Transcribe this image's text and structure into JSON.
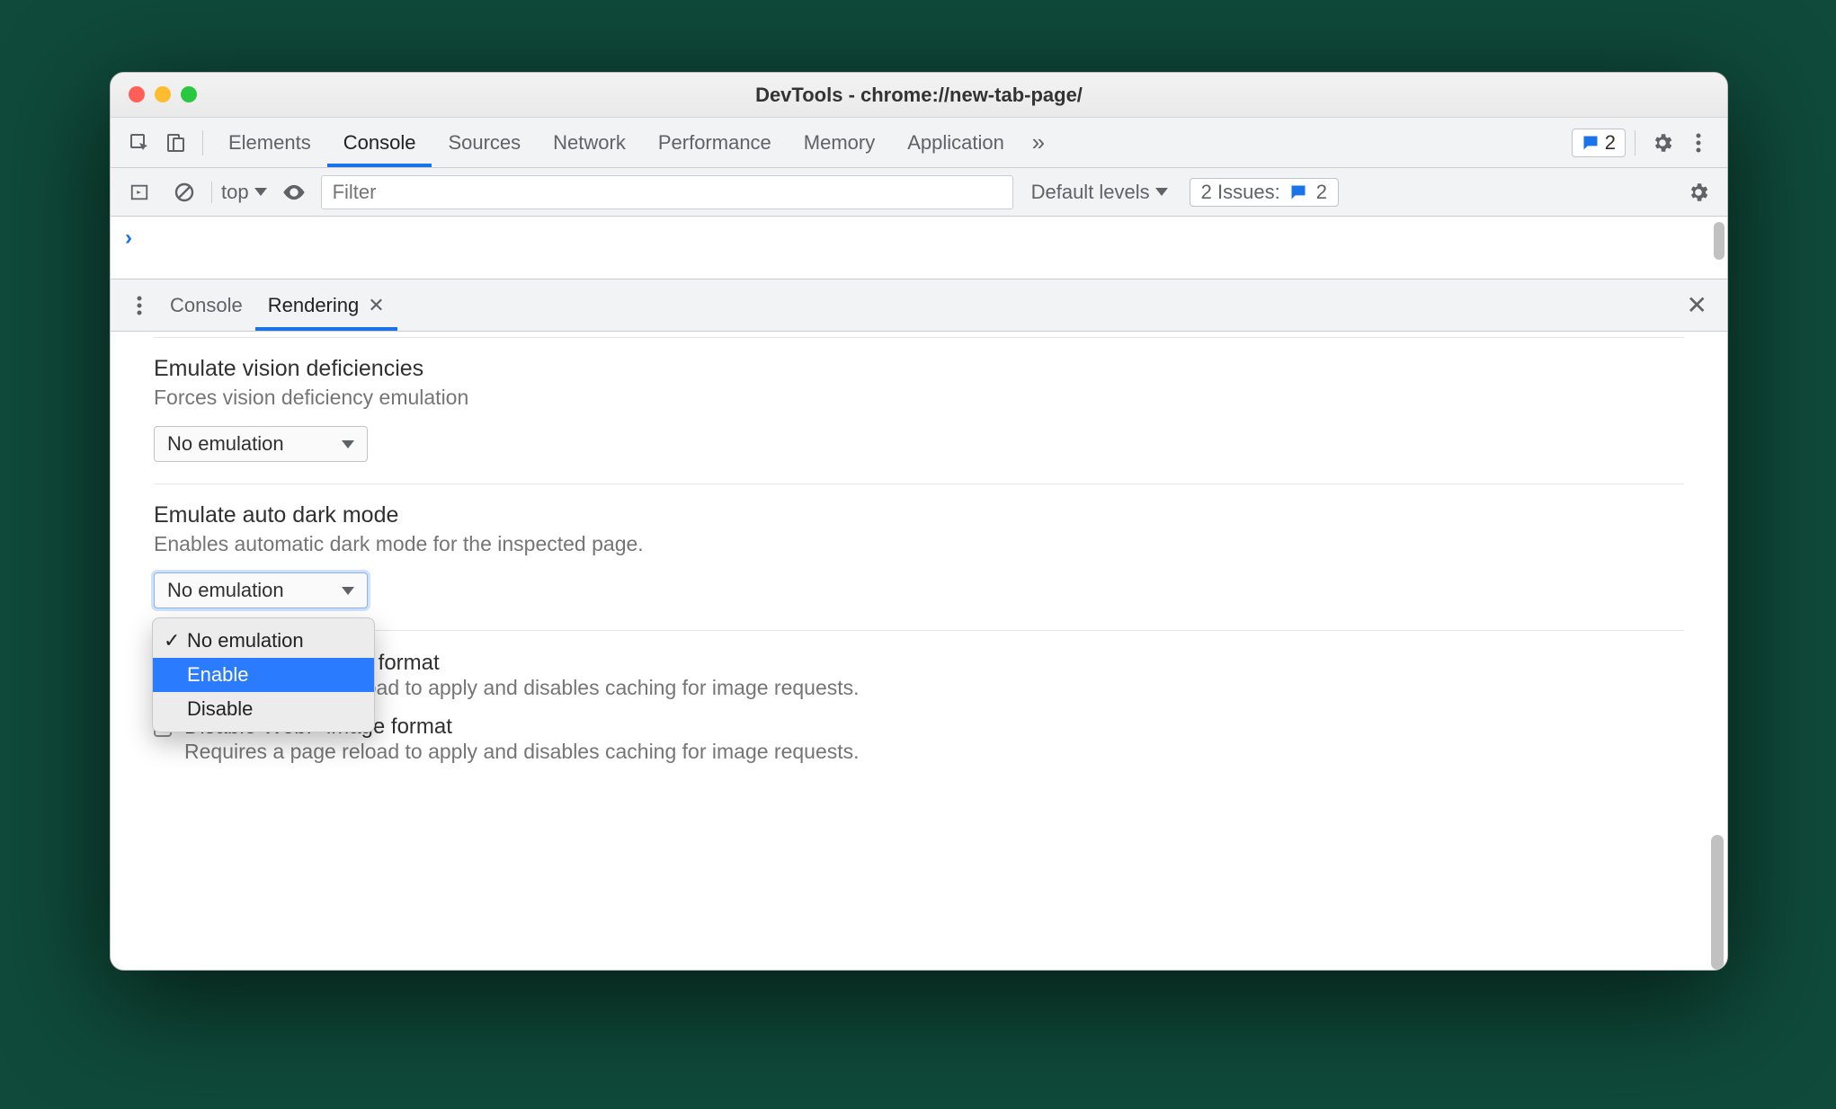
{
  "window": {
    "title": "DevTools - chrome://new-tab-page/"
  },
  "tabs": {
    "items": [
      "Elements",
      "Console",
      "Sources",
      "Network",
      "Performance",
      "Memory",
      "Application"
    ],
    "activeIndex": 1,
    "badgeCount": "2"
  },
  "console": {
    "context": "top",
    "filterPlaceholder": "Filter",
    "levelsLabel": "Default levels",
    "issuesLabel": "2 Issues:",
    "issuesCount": "2"
  },
  "drawer": {
    "tabs": [
      "Console",
      "Rendering"
    ],
    "activeIndex": 1
  },
  "rendering": {
    "vision": {
      "title": "Emulate vision deficiencies",
      "desc": "Forces vision deficiency emulation",
      "value": "No emulation"
    },
    "darkmode": {
      "title": "Emulate auto dark mode",
      "desc": "Enables automatic dark mode for the inspected page.",
      "value": "No emulation",
      "options": [
        "No emulation",
        "Enable",
        "Disable"
      ],
      "highlightedIndex": 1
    },
    "avif": {
      "title": "Disable AVIF image format",
      "desc": "Requires a page reload to apply and disables caching for image requests."
    },
    "webp": {
      "title": "Disable WebP image format",
      "desc": "Requires a page reload to apply and disables caching for image requests."
    }
  }
}
